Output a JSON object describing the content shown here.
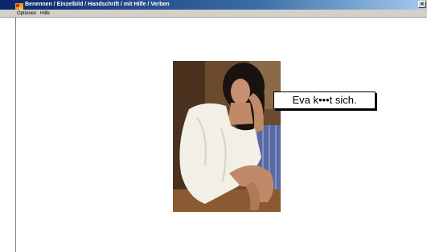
{
  "window": {
    "title": "Benennen / Einzelbild / Handschrift / mit Hilfe / Verben",
    "close_glyph": "×"
  },
  "menu": {
    "items": [
      "Optionen",
      "Hilfe"
    ]
  },
  "exercise": {
    "sentence": "Eva k•••t sich.",
    "image": "photo of a woman in a white bathrobe combing her hair"
  },
  "icons": {
    "app": "app-icon",
    "close": "close-icon"
  },
  "colors": {
    "titlebar_start": "#0a246a",
    "titlebar_end": "#a6caf0",
    "menubar": "#d4d0c8",
    "background": "#ffffff"
  }
}
